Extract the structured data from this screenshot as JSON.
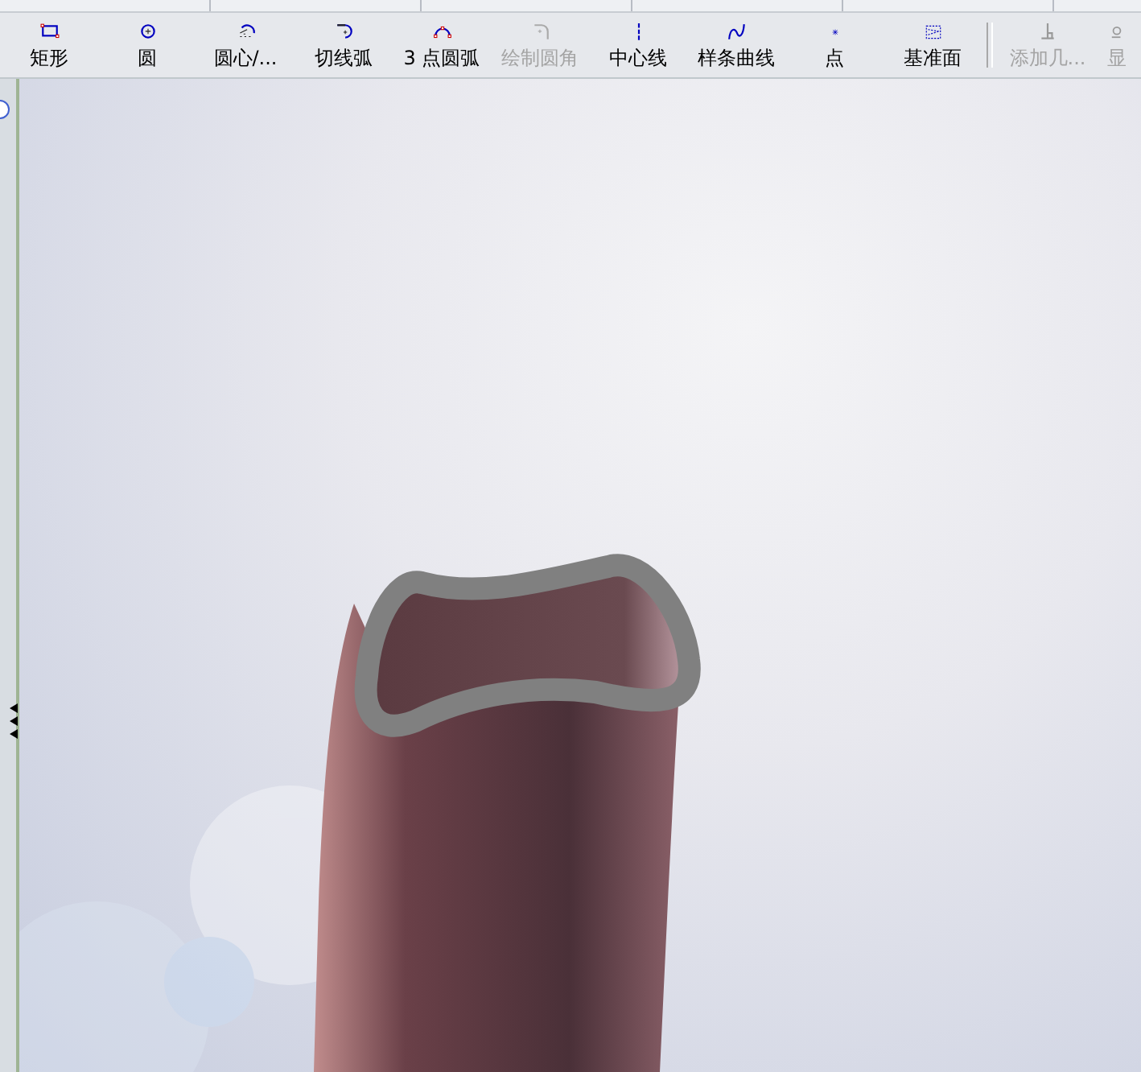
{
  "toolbar": {
    "items": [
      {
        "label": "矩形",
        "kind": "rectangle",
        "disabled": false
      },
      {
        "label": "圆",
        "kind": "circle",
        "disabled": false
      },
      {
        "label": "圆心/...",
        "kind": "center-arc",
        "disabled": false
      },
      {
        "label": "切线弧",
        "kind": "tangent-arc",
        "disabled": false
      },
      {
        "label": "3 点圆弧",
        "kind": "three-point-arc",
        "disabled": false
      },
      {
        "label": "绘制圆角",
        "kind": "fillet",
        "disabled": true
      },
      {
        "label": "中心线",
        "kind": "centerline",
        "disabled": false
      },
      {
        "label": "样条曲线",
        "kind": "spline",
        "disabled": false
      },
      {
        "label": "点",
        "kind": "point",
        "disabled": false
      },
      {
        "label": "基准面",
        "kind": "plane",
        "disabled": false
      },
      {
        "label": "添加几...",
        "kind": "relation",
        "disabled": true
      },
      {
        "label": "显",
        "kind": "display",
        "disabled": true
      }
    ]
  }
}
